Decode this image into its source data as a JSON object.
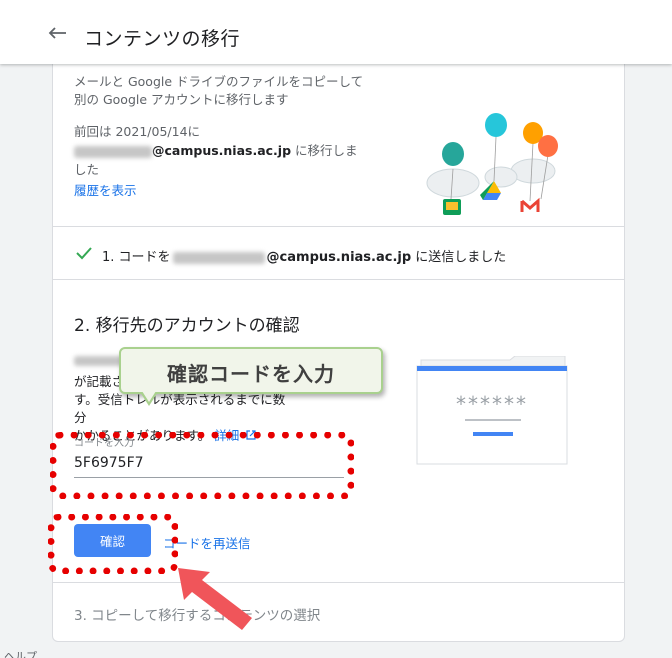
{
  "header": {
    "title": "コンテンツの移行",
    "back_icon": "arrow-back-icon"
  },
  "section1": {
    "description": "メールと Google ドライブのファイルをコピーして別の Google アカウントに移行します",
    "previous_prefix": "前回は 2021/05/14に",
    "previous_email_domain": "@campus.nias.ac.jp",
    "previous_suffix": " に移行しました",
    "history_link": "履歴を表示"
  },
  "section2": {
    "prefix": "1. コードを",
    "email_domain": "@campus.nias.ac.jp",
    "suffix": " に送信しました",
    "check_color": "#34a853"
  },
  "section3": {
    "title": "2. 移行先のアカウントの確認",
    "text_line1": "が記載さ",
    "text_line2": "す。受信トレ",
    "text_line2b": "ル",
    "text_line2c": "が表示されるまでに数分",
    "text_line3": "かかることがあります。",
    "details_link": "詳細",
    "input_label": "コードを入力",
    "input_value": "5F6975F7",
    "confirm_button": "確認",
    "resend_link": "コードを再送信",
    "illustration_stars": "******"
  },
  "section4": {
    "title": "3. コピーして移行するコンテンツの選択"
  },
  "footer": {
    "help": "ヘルプ"
  },
  "annotation": {
    "callout": "確認コードを入力",
    "highlight_color": "#e60000",
    "callout_border": "#a9d18e",
    "arrow_color": "#f0555a"
  },
  "colors": {
    "link": "#1a73e8",
    "button": "#4285f4"
  }
}
